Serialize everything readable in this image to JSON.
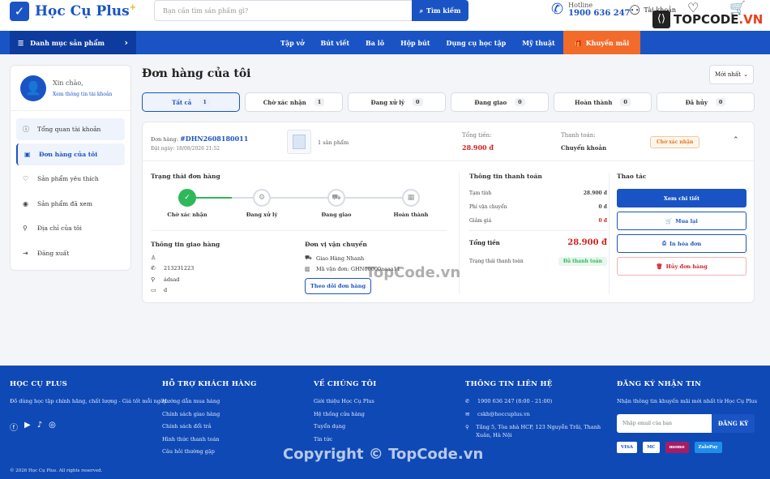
{
  "header": {
    "logo_text": "Học Cụ Plus",
    "logo_plus": "+",
    "search_placeholder": "Bạn cần tìm sản phẩm gì?",
    "search_button": "Tìm kiếm",
    "hotline_label": "Hotline",
    "hotline_number": "1900 636 247",
    "account_label": "Tài khoản",
    "watermark_logo": "TOPCODE",
    "watermark_logo_suffix": ".VN"
  },
  "nav": {
    "category_label": "Danh mục sản phẩm",
    "items": [
      "Tập vở",
      "Bút viết",
      "Ba lô",
      "Hộp bút",
      "Dụng cụ học tập",
      "Mỹ thuật"
    ],
    "promo": "Khuyến mãi"
  },
  "sidebar": {
    "greeting": "Xin chào,",
    "view_account": "Xem thông tin tài khoản",
    "items": [
      {
        "label": "Tổng quan tài khoản",
        "icon": "info-icon"
      },
      {
        "label": "Đơn hàng của tôi",
        "icon": "bag-icon"
      },
      {
        "label": "Sản phẩm yêu thích",
        "icon": "heart-icon"
      },
      {
        "label": "Sản phẩm đã xem",
        "icon": "eye-icon"
      },
      {
        "label": "Địa chỉ của tôi",
        "icon": "pin-icon"
      },
      {
        "label": "Đăng xuất",
        "icon": "logout-icon"
      }
    ]
  },
  "main": {
    "title": "Đơn hàng của tôi",
    "sort": "Mới nhất",
    "tabs": [
      {
        "label": "Tất cả",
        "count": "1"
      },
      {
        "label": "Chờ xác nhận",
        "count": "1"
      },
      {
        "label": "Đang xử lý",
        "count": "0"
      },
      {
        "label": "Đang giao",
        "count": "0"
      },
      {
        "label": "Hoàn thành",
        "count": "0"
      },
      {
        "label": "Đã hủy",
        "count": "0"
      }
    ]
  },
  "order": {
    "code_label": "Đơn hàng:",
    "code": "#DHN2608180011",
    "date": "Đặt ngày: 18/08/2026 21:52",
    "qty": "1 sản phẩm",
    "total_label": "Tổng tiền:",
    "total": "28.900 đ",
    "pay_label": "Thanh toán:",
    "pay_method": "Chuyển khoản",
    "status": "Chờ xác nhận",
    "status_title": "Trạng thái đơn hàng",
    "steps": [
      "Chờ xác nhận",
      "Đang xử lý",
      "Đang giao",
      "Hoàn thành"
    ],
    "ship_title": "Thông tin giao hàng",
    "ship_name": "",
    "ship_phone": "213231223",
    "ship_address": "ádsad",
    "ship_note": "d",
    "carrier_title": "Đơn vị vận chuyển",
    "carrier_name": "Giao Hàng Nhanh",
    "carrier_code": "Mã vận đơn: GHN00000aaaa11",
    "track_button": "Theo dõi đơn hàng",
    "payment_title": "Thông tin thanh toán",
    "subtotal_label": "Tạm tính",
    "subtotal": "28.900 đ",
    "shipping_label": "Phí vận chuyển",
    "shipping": "0 đ",
    "discount_label": "Giảm giá",
    "discount": "0 đ",
    "grand_label": "Tổng tiền",
    "grand": "28.900 đ",
    "paystatus_label": "Trạng thái thanh toán",
    "paystatus": "Đã thanh toán",
    "actions_title": "Thao tác",
    "actions": [
      "Xem chi tiết",
      "Mua lại",
      "In hóa đơn",
      "Hủy đơn hàng"
    ]
  },
  "watermarks": {
    "center": "TopCode.vn",
    "footer": "Copyright © TopCode.vn"
  },
  "footer": {
    "brand": "HỌC CỤ PLUS",
    "brand_desc": "Đồ dùng học tập chính hãng, chất lượng - Giá tốt mỗi ngày.",
    "support_title": "HỖ TRỢ KHÁCH HÀNG",
    "support_links": [
      "Hướng dẫn mua hàng",
      "Chính sách giao hàng",
      "Chính sách đổi trả",
      "Hình thức thanh toán",
      "Câu hỏi thường gặp"
    ],
    "about_title": "VỀ CHÚNG TÔI",
    "about_links": [
      "Giới thiệu Học Cụ Plus",
      "Hệ thống cửa hàng",
      "Tuyển dụng",
      "Tin tức"
    ],
    "contact_title": "THÔNG TIN LIÊN HỆ",
    "contact_phone": "1900 636 247 (8:00 - 21:00)",
    "contact_email": "cskh@hoccuplus.vn",
    "contact_address": "Tầng 5, Tòa nhà HCP, 123 Nguyễn Trãi, Thanh Xuân, Hà Nội",
    "news_title": "ĐĂNG KÝ NHẬN TIN",
    "news_desc": "Nhận thông tin khuyến mãi mới nhất từ Học Cụ Plus",
    "news_placeholder": "Nhập email của bạn",
    "news_button": "ĐĂNG KÝ",
    "payments": [
      "VISA",
      "MC",
      "momo",
      "ZaloPay"
    ],
    "copyright": "© 2026 Học Cụ Plus. All rights reserved."
  },
  "colors": {
    "primary": "#1a54c4",
    "promo": "#f26b2a",
    "success": "#2fb85a",
    "danger": "#d21f1f",
    "footer": "#0f49b6"
  }
}
